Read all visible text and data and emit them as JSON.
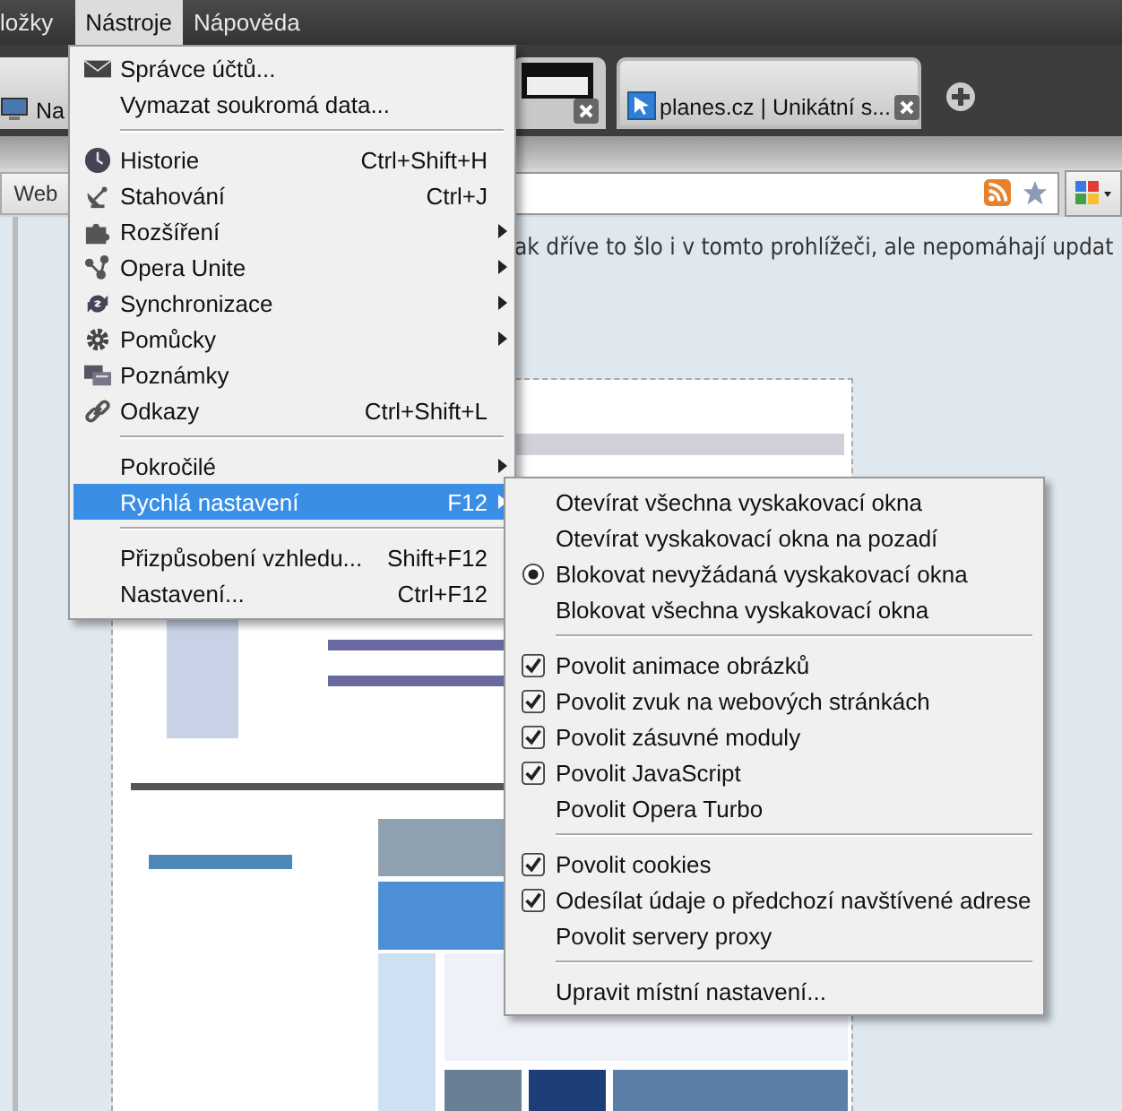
{
  "menu_bar": [
    {
      "label": "ložky",
      "selected": false
    },
    {
      "label": "Nástroje",
      "selected": true
    },
    {
      "label": "Nápověda",
      "selected": false
    }
  ],
  "tabs": [
    {
      "title": "Na",
      "kind": "page"
    },
    {
      "kind": "thumb"
    },
    {
      "title": "planes.cz | Unikátní s...",
      "kind": "page"
    }
  ],
  "address_bar": {
    "search_button": "Web"
  },
  "page": {
    "text": "ak dříve to šlo i v tomto prohlížeči, ale nepomáhají updat"
  },
  "tools_menu": [
    {
      "kind": "item",
      "label": "Správce účtů..."
    },
    {
      "kind": "item",
      "label": "Vymazat soukromá data..."
    },
    {
      "kind": "separator"
    },
    {
      "kind": "item",
      "label": "Historie",
      "shortcut": "Ctrl+Shift+H"
    },
    {
      "kind": "item",
      "label": "Stahování",
      "shortcut": "Ctrl+J"
    },
    {
      "kind": "item",
      "label": "Rozšíření",
      "submenu": true
    },
    {
      "kind": "item",
      "label": "Opera Unite",
      "submenu": true
    },
    {
      "kind": "item",
      "label": "Synchronizace",
      "submenu": true
    },
    {
      "kind": "item",
      "label": "Pomůcky",
      "submenu": true
    },
    {
      "kind": "item",
      "label": "Poznámky"
    },
    {
      "kind": "item",
      "label": "Odkazy",
      "shortcut": "Ctrl+Shift+L"
    },
    {
      "kind": "separator"
    },
    {
      "kind": "item",
      "label": "Pokročilé",
      "submenu": true
    },
    {
      "kind": "item",
      "label": "Rychlá nastavení",
      "shortcut": "F12",
      "submenu": true,
      "selected": true
    },
    {
      "kind": "separator"
    },
    {
      "kind": "item",
      "label": "Přizpůsobení vzhledu...",
      "shortcut": "Shift+F12"
    },
    {
      "kind": "item",
      "label": "Nastavení...",
      "shortcut": "Ctrl+F12"
    }
  ],
  "quick_settings_menu": [
    {
      "kind": "radio",
      "label": "Otevírat všechna vyskakovací okna",
      "selected": false
    },
    {
      "kind": "radio",
      "label": "Otevírat vyskakovací okna na pozadí",
      "selected": false
    },
    {
      "kind": "radio",
      "label": "Blokovat nevyžádaná vyskakovací okna",
      "selected": true
    },
    {
      "kind": "radio",
      "label": "Blokovat všechna vyskakovací okna",
      "selected": false
    },
    {
      "kind": "separator"
    },
    {
      "kind": "check",
      "label": "Povolit animace obrázků",
      "checked": true
    },
    {
      "kind": "check",
      "label": "Povolit zvuk na webových stránkách",
      "checked": true
    },
    {
      "kind": "check",
      "label": "Povolit zásuvné moduly",
      "checked": true
    },
    {
      "kind": "check",
      "label": "Povolit JavaScript",
      "checked": true
    },
    {
      "kind": "check",
      "label": "Povolit Opera Turbo",
      "checked": false
    },
    {
      "kind": "separator"
    },
    {
      "kind": "check",
      "label": "Povolit cookies",
      "checked": true
    },
    {
      "kind": "check",
      "label": "Odesílat údaje o předchozí navštívené adrese",
      "checked": true
    },
    {
      "kind": "check",
      "label": "Povolit servery proxy",
      "checked": false
    },
    {
      "kind": "separator"
    },
    {
      "kind": "item",
      "label": "Upravit místní nastavení..."
    }
  ]
}
